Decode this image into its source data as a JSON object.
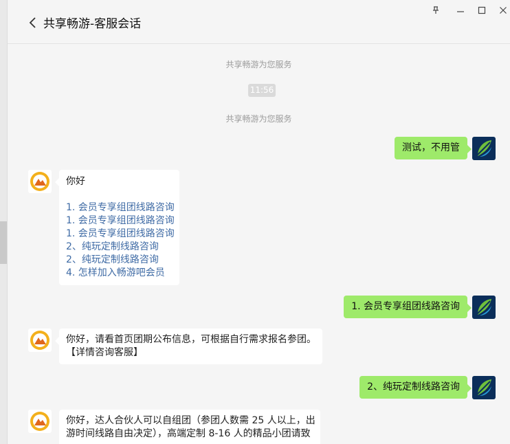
{
  "window": {
    "title": "共享畅游-客服会话",
    "controls": [
      "pin-icon",
      "minimize-icon",
      "maximize-icon",
      "close-icon"
    ]
  },
  "chat": {
    "system_notice_1": "共享畅游为您服务",
    "timestamp": "11:56",
    "system_notice_2": "共享畅游为您服务",
    "messages": [
      {
        "from": "user",
        "text": "测试，不用管"
      },
      {
        "from": "agent",
        "greeting": "你好",
        "options": [
          "1. 会员专享组团线路咨询",
          "1. 会员专享组团线路咨询",
          "1. 会员专享组团线路咨询",
          "2、纯玩定制线路咨询",
          "2、纯玩定制线路咨询",
          "4. 怎样加入畅游吧会员"
        ]
      },
      {
        "from": "user",
        "text": "1. 会员专享组团线路咨询"
      },
      {
        "from": "agent",
        "lines": [
          "你好，请看首页团期公布信息，可根据自行需求报名参团。",
          "【详情咨询客服】"
        ]
      },
      {
        "from": "user",
        "text": "2、纯玩定制线路咨询"
      },
      {
        "from": "agent",
        "lines": [
          "你好，达人合伙人可以自组团（参团人数需 25 人以上，出",
          "游时间线路自由决定），高端定制 8-16 人的精品小团请致"
        ]
      }
    ]
  },
  "colors": {
    "user_bubble": "#9eea6a",
    "agent_bubble": "#ffffff",
    "link": "#3f6ba5",
    "background": "#f5f5f5"
  },
  "icons": {
    "agent_avatar": "mountain-logo-icon",
    "user_avatar": "leaf-logo-icon"
  }
}
